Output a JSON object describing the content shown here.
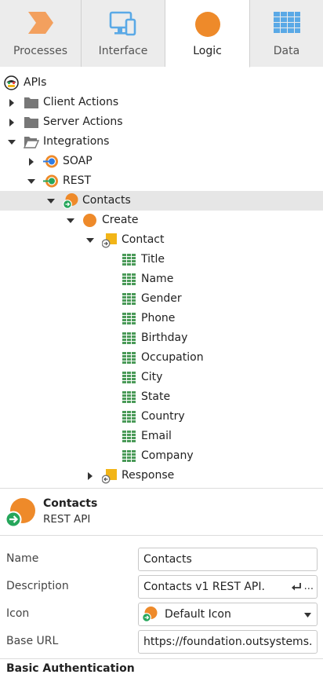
{
  "tabs": [
    {
      "label": "Processes",
      "icon": "processes-icon"
    },
    {
      "label": "Interface",
      "icon": "interface-icon"
    },
    {
      "label": "Logic",
      "icon": "logic-icon"
    },
    {
      "label": "Data",
      "icon": "data-icon"
    }
  ],
  "active_tab": "Logic",
  "tree": {
    "root": "APIs",
    "client_actions": "Client Actions",
    "server_actions": "Server Actions",
    "integrations": "Integrations",
    "soap": "SOAP",
    "rest": "REST",
    "contacts": "Contacts",
    "create": "Create",
    "contact": "Contact",
    "attributes": [
      "Title",
      "Name",
      "Gender",
      "Phone",
      "Birthday",
      "Occupation",
      "City",
      "State",
      "Country",
      "Email",
      "Company"
    ],
    "response": "Response"
  },
  "selection": {
    "name": "Contacts",
    "type": "REST API"
  },
  "properties": {
    "name_label": "Name",
    "name_value": "Contacts",
    "description_label": "Description",
    "description_value": "Contacts v1 REST API.",
    "description_more": "...",
    "icon_label": "Icon",
    "icon_value": "Default Icon",
    "base_url_label": "Base URL",
    "base_url_value": "https://foundation.outsystems.",
    "basic_auth_title": "Basic Authentication"
  },
  "colors": {
    "orange": "#ee8a2a",
    "green": "#26a65b",
    "blue": "#2e7ce6",
    "grid_green": "#4a9a58",
    "yellow": "#f2b517",
    "tab_blue": "#5aa9e6",
    "tab_orange": "#f3a05e"
  }
}
